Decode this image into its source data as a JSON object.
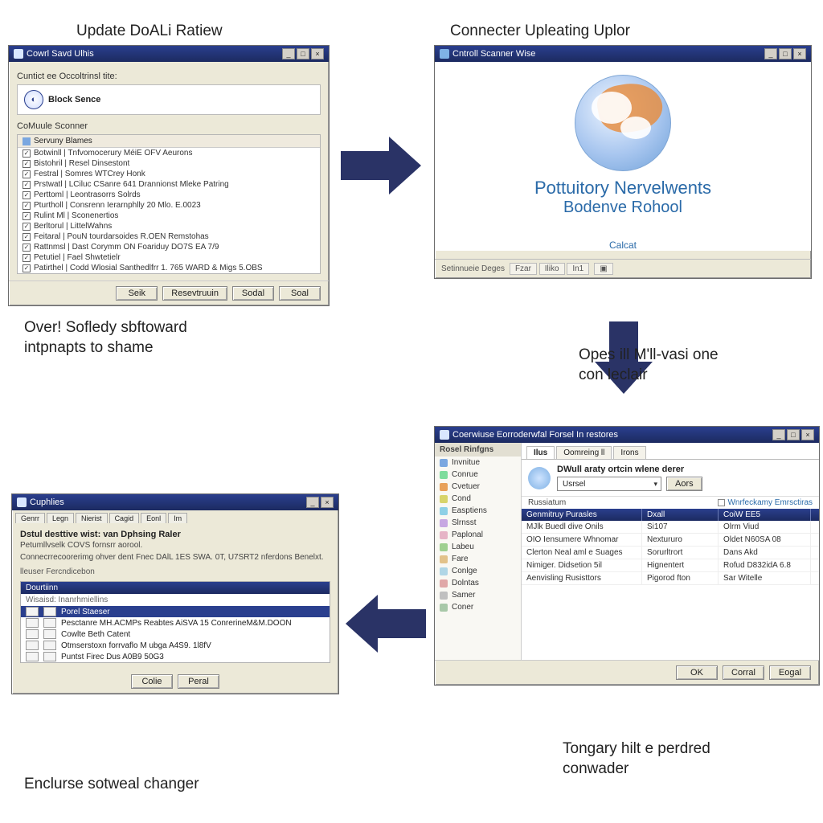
{
  "headings": {
    "top_left": "Update DoALi Ratiew",
    "top_right": "Connecter Upleating Uplor"
  },
  "captions": {
    "under_w1_line1": "Over! Sofledy sbftoward",
    "under_w1_line2": "intpnapts to shame",
    "beside_w2_line1": "Opes ill M'll-vasi one",
    "beside_w2_line2": "con leclair",
    "under_w3_line1": "Tongary hilt e perdred",
    "under_w3_line2": "conwader",
    "under_w4": "Enclurse sotweal changer"
  },
  "window1": {
    "title": "Cowrl Savd Ulhis",
    "field_label": "Cuntict ee Occoltrinsl tite:",
    "block_name": "Block Sence",
    "scanner_label": "CoMuule Sconner",
    "group_header": "Servuny Blames",
    "items": [
      "Botwinll | Tnfvomocerury MéiE OFV Aeurons",
      "Bistohril | Resel Dinsestont",
      "Festral | Somres WTCrey Honk",
      "Prstwatl | LCiluc CSanre 641 Drannionst Mleke Patring",
      "Perttoml | Leontrasorrs Solrds",
      "Pturtholl | Consrenn Ierarnphlly 20 Mlo. E.0023",
      "Rulint Ml | Sconenertios",
      "Berltorul | LittelWahns",
      "Feitaral | PouN tourdarsoides R.OEN Remstohas",
      "Rattnmsl | Dast Corymm ON Foariduy DO7S EA 7/9",
      "Petutiel | Fael Shwtetielr",
      "Patirthel | Codd Wlosial Santhedlfrr 1. 765 WARD & Migs 5.OBS"
    ],
    "buttons": [
      "Seik",
      "Resevtruuin",
      "Sodal",
      "Soal"
    ]
  },
  "window2": {
    "title": "Cntroll Scanner Wise",
    "brand_line1": "Pottuitory Nervelwents",
    "brand_line2": "Bodenve Rohool",
    "cancel": "Calcat",
    "status_left": "Setinnueie Deges",
    "status_items": [
      "Fzar",
      "Iliko",
      "In1"
    ]
  },
  "window3": {
    "title": "Coerwiuse Eorroderwfal Forsel In restores",
    "sidebar_title": "Rosel Rinfgns",
    "sidebar_items": [
      {
        "label": "Invnitue",
        "color": "#7aa7e0"
      },
      {
        "label": "Conrue",
        "color": "#7edc9c"
      },
      {
        "label": "Cvetuer",
        "color": "#e8a15a"
      },
      {
        "label": "Cond",
        "color": "#d8d46a"
      },
      {
        "label": "Easptiens",
        "color": "#8ed0e6"
      },
      {
        "label": "Slrnsst",
        "color": "#c7a7e2"
      },
      {
        "label": "Paplonal",
        "color": "#e6b4c6"
      },
      {
        "label": "Labeu",
        "color": "#9fd090"
      },
      {
        "label": "Fare",
        "color": "#e2c28a"
      },
      {
        "label": "Conlge",
        "color": "#b0d6e6"
      },
      {
        "label": "Dolntas",
        "color": "#e0a8a8"
      },
      {
        "label": "Samer",
        "color": "#c0c0c0"
      },
      {
        "label": "Coner",
        "color": "#a8c8a8"
      }
    ],
    "tabs": [
      "Ilus",
      "Oomreing ll",
      "Irons"
    ],
    "header_title": "DWull araty ortcin wlene derer",
    "dropdown_value": "Usrsel",
    "dropdown_btn": "Aors",
    "sub_left": "Russiatum",
    "sub_right": "Wnrfeckamy Emrsctiras",
    "columns": [
      "Genmitruy Purasles",
      "Dxall",
      "CoiW EE5"
    ],
    "rows": [
      [
        "MJlk Buedl dive Onils",
        "Si107",
        "Olrm Viud"
      ],
      [
        "OIO Iensumere Whnomar",
        "Nextururo",
        "Oldet N60SA 08"
      ],
      [
        "Clerton Neal aml e Suages",
        "Sorurltrort",
        "Dans Akd"
      ],
      [
        "Nimiger. Didsetion 5il",
        "Hignentert",
        "Rofud D832idA 6.8"
      ],
      [
        "Aenvisling Rusisttors",
        "Pigorod fton",
        "Sar Witelle"
      ]
    ],
    "buttons": [
      "OK",
      "Corral",
      "Eogal"
    ]
  },
  "window4": {
    "title": "Cuphlies",
    "tabs": [
      "Genrr",
      "Legn",
      "Nierist",
      "Cagid",
      "Eonl",
      "Im"
    ],
    "main_heading": "Dstul desttive wist: van Dphsing Raler",
    "line1": "Petumllvselk COVS fornsrr aorool.",
    "line2": "Connecrrecoorerimg ohver dent Fnec DAlL 1ES SWA. 0T, U7SRT2 nferdons Benelxt.",
    "group_label": "lleuser Fercndicebon",
    "frame_head": "Dourtiinn",
    "frame_sub": "Wisaisd: Inanrhmiellins",
    "selected": "Porel Staeser",
    "list": [
      "Pesctanre MH.ACMPs Reabtes AiSVA 15 ConrerineM&M.DOON",
      "Cowlte Beth Catent",
      "Otmserstoxn forrvaflo M ubga A4S9. 1l8fV",
      "Puntst Firec Dus A0B9 50G3"
    ],
    "buttons": [
      "Colie",
      "Peral"
    ]
  }
}
